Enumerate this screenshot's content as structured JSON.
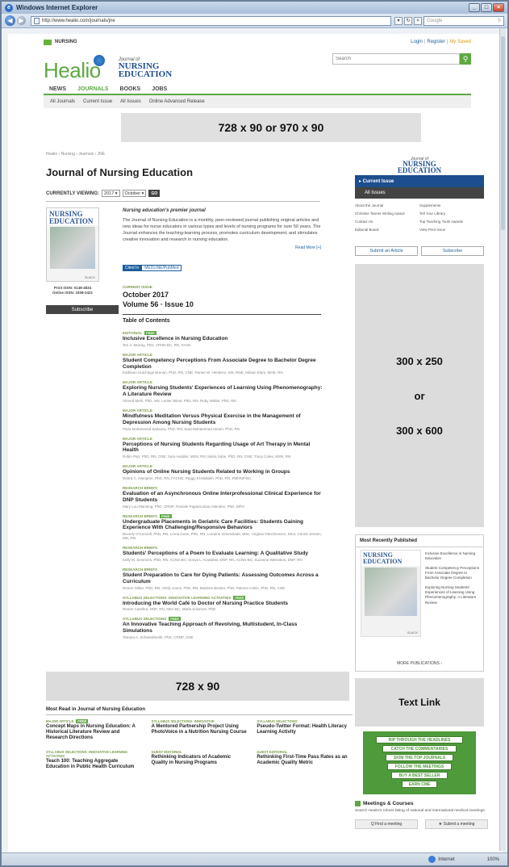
{
  "browser": {
    "title": "Windows Internet Explorer",
    "address": "http://www.healio.com/journals/jne",
    "search_placeholder": "Google",
    "status_zone": "Internet",
    "zoom": "100%"
  },
  "site": {
    "section_tag": "NURSING",
    "login": "Login",
    "register": "Register",
    "my_saved": "My Saved",
    "search_placeholder": "Search",
    "logo": "Healio",
    "journal_logo_top": "Journal of",
    "journal_logo_line1": "NURSING",
    "journal_logo_line2": "EDUCATION",
    "nav": [
      "NEWS",
      "JOURNALS",
      "BOOKS",
      "JOBS"
    ],
    "subnav": [
      "All Journals",
      "Current Issue",
      "All Issues",
      "Online Advanced Release"
    ]
  },
  "ads": {
    "top": "728 x 90 or 970 x 90",
    "side_line1": "300 x 250",
    "side_line2": "or",
    "side_line3": "300 x 600",
    "bottom": "728 x 90",
    "text_link": "Text Link"
  },
  "main": {
    "breadcrumb": "Healio › Nursing › Journals › JNE",
    "title": "Journal of Nursing Education",
    "viewing_label": "CURRENTLY VIEWING:",
    "year": "2017 ▾",
    "month": "October ▾",
    "go": "GO",
    "cover_title1": "NURSING",
    "cover_title2": "EDUCATION",
    "cover_slack": "SLACK",
    "print_issn": "Print ISSN: 0148-4834",
    "online_issn": "Online ISSN: 1938-2421",
    "subscribe": "Subscribe",
    "tagline": "Nursing education's premier journal",
    "description": "The Journal of Nursing Education is a monthly, peer-reviewed journal publishing original articles and new ideas for nurse educators in various types and levels of nursing programs for over 50 years. The Journal enhances the teaching-learning process, promotes curriculum development, and stimulates creative innovation and research in nursing education.",
    "read_more": "Read More [+]",
    "cited_in": "Cited In",
    "cited_in_db": "MEDLINE/PubMed",
    "current_issue_label": "CURRENT ISSUE",
    "issue_date": "October 2017",
    "volume": "Volume 56 · Issue 10",
    "toc_heading": "Table of Contents",
    "free_label": "FREE"
  },
  "toc": [
    {
      "cat": "EDITORIAL",
      "free": true,
      "title": "Inclusive Excellence in Nursing Education",
      "authors": "Teri A. Murray, PhD, APHN-BC, RN, FAAN"
    },
    {
      "cat": "MAJOR ARTICLE",
      "free": false,
      "title": "Student Competency Perceptions From Associate Degree to Bachelor Degree Completion",
      "authors": "Kathleen Hutchings Brenan, PhD, RN, CNE; Renee W. Henkens, MS, RNE; Miriam Elam, MHE, RN"
    },
    {
      "cat": "MAJOR ARTICLE",
      "free": false,
      "title": "Exploring Nursing Students' Experiences of Learning Using Phenomenography: A Literature Review",
      "authors": "Ahmed Mehi, PhD, MS; Lester Wiest, PhD, RN; Ruby Walter, PhD, RN"
    },
    {
      "cat": "MAJOR ARTICLE",
      "free": false,
      "title": "Mindfulness Meditation Versus Physical Exercise in the Management of Depression Among Nursing Students",
      "authors": "Paris Mohammed Zaitouny, PhD, RN; Sara Mohammed Akram, PhD, RN"
    },
    {
      "cat": "MAJOR ARTICLE",
      "free": false,
      "title": "Perceptions of Nursing Students Regarding Usage of Art Therapy in Mental Health",
      "authors": "Robin Parr, PhD, RN, CNE; Sara Hodder, MSN, RN; Maria Sube, PhD, RN, CNE; Tracy Coles, MSN, RN"
    },
    {
      "cat": "MAJOR ARTICLE",
      "free": false,
      "title": "Opinions of Online Nursing Students Related to Working in Groups",
      "authors": "Debra C. Hampton, PhD, RN, FACHE; Peggy El-Mallakh, PhD, RN, PMHNP-BC"
    },
    {
      "cat": "RESEARCH BRIEFS",
      "free": false,
      "title": "Evaluation of an Asynchronous Online Interprofessional Clinical Experience for DNP Students",
      "authors": "Mary Lou Manning, PhD, CRNP; Rosalie Papanicolaou Mendez, PhD, MPH"
    },
    {
      "cat": "RESEARCH BRIEFS",
      "free": true,
      "title": "Undergraduate Placements in Geriatric Care Facilities: Students Gaining Experience With Challenging/Responsive Behaviors",
      "authors": "Beverly O'Connell, PhD, RN; Lorna Guse, PhD, RN; Lorraine Greenslade, MSc; Virginia Ottochinesco, MLS; Carole Jensen, MN, RN"
    },
    {
      "cat": "RESEARCH BRIEFS",
      "free": false,
      "title": "Students' Perceptions of a Poem to Evaluate Learning: A Qualitative Study",
      "authors": "Kelly M. Simmons, PhD, RN, ACNS-BC; Sonya L. Kowalski, DNP, RN, ACNS-BC; Suzanne Weinstein, DNP, RN"
    },
    {
      "cat": "RESEARCH BRIEFS",
      "free": false,
      "title": "Student Preparation to Care for Dying Patients: Assessing Outcomes Across a Curriculum",
      "authors": "Renee Gillan, PhD, RN; Verily Jones, PhD, RN; Marlene Becker, PhD; Patricia Cahin, PhD, RN, CNE"
    },
    {
      "cat": "SYLLABUS SELECTIONS: INNOVATIVE LEARNING ACTIVITIES",
      "free": true,
      "title": "Introducing the World Café to Doctor of Nursing Practice Students",
      "authors": "Renee Cawthra, DNP, RN, NEA-BC; Marla Solomon, PhD"
    },
    {
      "cat": "SYLLABUS SELECTIONS",
      "free": true,
      "title": "An Innovative Teaching Approach of Revolving, Multistudent, In-Class Simulations",
      "authors": "Tamara A. Schwindmeith, PhD, CRNP, CNE"
    }
  ],
  "sidebar": {
    "logo_top": "Journal of",
    "logo_line1": "NURSING",
    "logo_line2": "EDUCATION",
    "current_issue": "▸ Current Issue",
    "all_issues": "All Issues",
    "links": [
      "About the Journal",
      "Supplements",
      "Christine Tanner Writing Award",
      "Tell Your Library",
      "Contact Us",
      "Top Teaching Tools Awards",
      "Editorial Board",
      "View Print Issue"
    ],
    "submit_article": "Submit an Article",
    "subscribe": "Subscribe",
    "mrp_heading": "Most Recently Published",
    "mrp_items": [
      "Inclusive Excellence in Nursing Education",
      "Student Competency Perceptions From Associate Degree to Bachelor Degree Completion",
      "Exploring Nursing Students' Experiences of Learning Using Phenomenography: A Literature Review"
    ],
    "mrp_more": "MORE PUBLICATIONS ›",
    "cme_rows": [
      "RIP THROUGH THE HEADLINES",
      "CATCH THE COMMENTARIES",
      "SKIM THE TOP JOURNALS",
      "FOLLOW THE MEETINGS",
      "BUY A BEST SELLER",
      "EARN CME"
    ],
    "meetings_heading": "Meetings & Courses",
    "meetings_desc": "Search Healio's robust listing of national and international medical meetings.",
    "find_meeting": "Q Find a meeting",
    "submit_meeting": "★ Submit a meeting"
  },
  "most_read": {
    "heading": "Most Read in Journal of Nursing Education",
    "items": [
      {
        "cat": "MAJOR ARTICLE",
        "free": true,
        "title": "Concept Maps in Nursing Education: A Historical Literature Review and Research Directions"
      },
      {
        "cat": "SYLLABUS SELECTIONS: INNOVATIVE",
        "free": false,
        "title": "A Mentored Partnership Project Using PhotoVoice in a Nutrition Nursing Course"
      },
      {
        "cat": "SYLLABUS SELECTIONS",
        "free": false,
        "title": "Pseudo-Twitter Format: Health Literacy Learning Activity"
      },
      {
        "cat": "SYLLABUS SELECTIONS: INNOVATIVE LEARNING ACTIVITIES",
        "free": false,
        "title": "Teach 100: Teaching Aggregate Education in Public Health Curriculum"
      },
      {
        "cat": "GUEST EDITORIAL",
        "free": false,
        "title": "Rethinking Indicators of Academic Quality in Nursing Programs"
      },
      {
        "cat": "GUEST EDITORIAL",
        "free": false,
        "title": "Rethinking First-Time Pass Rates as an Academic Quality Metric"
      }
    ]
  }
}
